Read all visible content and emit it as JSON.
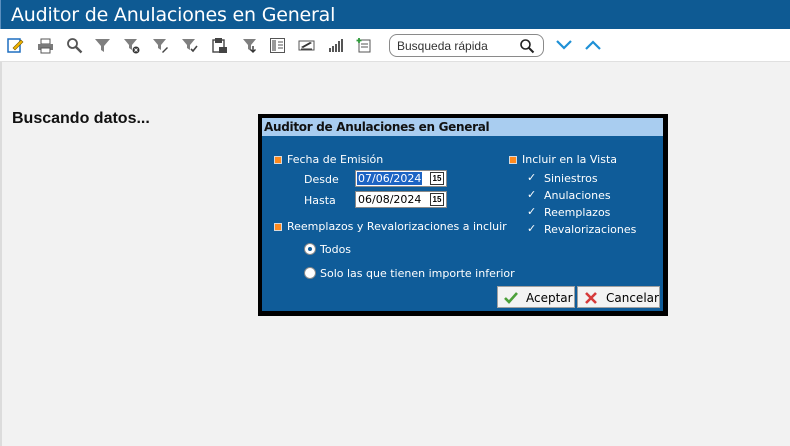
{
  "window": {
    "title": "Auditor de Anulaciones en General"
  },
  "toolbar": {
    "icons": [
      "edit-icon",
      "print-icon",
      "zoom-icon",
      "filter-icon",
      "filter-clear-icon",
      "filter-edit-icon",
      "filter-apply-icon",
      "export-icon",
      "download-icon",
      "columns-icon",
      "signature-icon",
      "chart-icon",
      "add-record-icon"
    ],
    "search": {
      "placeholder": "Busqueda rápida"
    }
  },
  "main": {
    "status": "Buscando datos..."
  },
  "dialog": {
    "title": "Auditor de Anulaciones en General",
    "emission": {
      "label": "Fecha de Emisión",
      "from_label": "Desde",
      "from_value": "07/06/2024",
      "to_label": "Hasta",
      "to_value": "06/08/2024",
      "calendar_glyph": "15"
    },
    "replacements": {
      "label": "Reemplazos y Revalorizaciones a incluir",
      "options": [
        "Todos",
        "Solo las que tienen importe inferior"
      ],
      "selected": "Todos"
    },
    "view": {
      "label": "Incluir en la Vista",
      "items": [
        "Siniestros",
        "Anulaciones",
        "Reemplazos",
        "Revalorizaciones"
      ]
    },
    "buttons": {
      "accept": "Aceptar",
      "cancel": "Cancelar"
    }
  },
  "colors": {
    "titlebar": "#0e5a93",
    "dialog": "#0f5c99",
    "dialog_header": "#a9cdf0",
    "accent": "#ff8a1e",
    "nav_arrow": "#1e90d6"
  }
}
